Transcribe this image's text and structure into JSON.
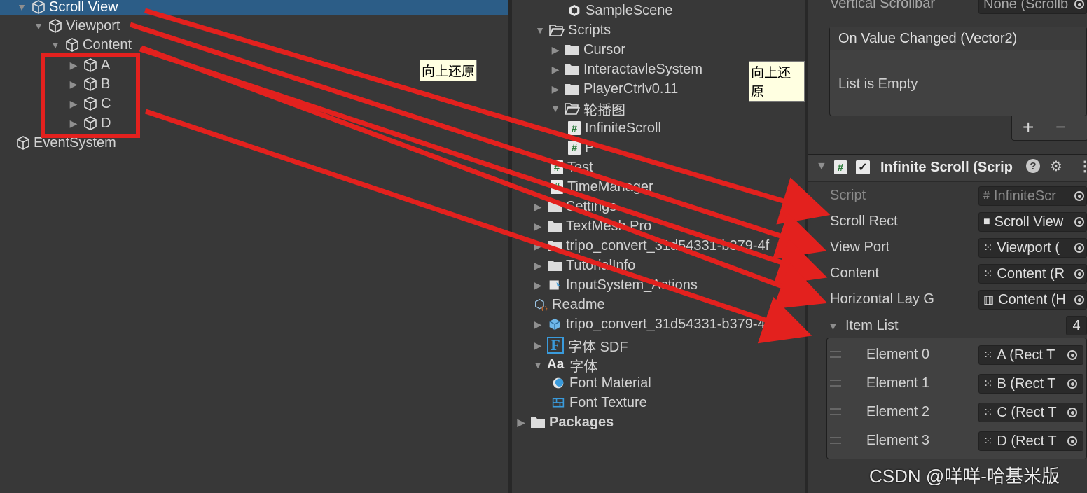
{
  "hierarchy": {
    "items": [
      {
        "label": "Scroll View",
        "expanded": true,
        "selected": true
      },
      {
        "label": "Viewport",
        "expanded": true
      },
      {
        "label": "Content",
        "expanded": true
      },
      {
        "label": "A"
      },
      {
        "label": "B"
      },
      {
        "label": "C"
      },
      {
        "label": "D"
      },
      {
        "label": "EventSystem"
      }
    ],
    "tooltip": "向上还原"
  },
  "project": {
    "items": [
      {
        "label": "SampleScene",
        "icon": "unity-scene-icon"
      },
      {
        "label": "Scripts",
        "icon": "folder-open-icon"
      },
      {
        "label": "Cursor",
        "icon": "folder-icon"
      },
      {
        "label": "InteractavleSystem",
        "icon": "folder-icon"
      },
      {
        "label": "PlayerCtrlv0.11",
        "icon": "folder-icon"
      },
      {
        "label": "轮播图",
        "icon": "folder-open-icon"
      },
      {
        "label": "InfiniteScroll",
        "icon": "script-icon"
      },
      {
        "label": "P",
        "icon": "script-icon"
      },
      {
        "label": "Test",
        "icon": "script-icon"
      },
      {
        "label": "TimeManager",
        "icon": "script-icon"
      },
      {
        "label": "Settings",
        "icon": "folder-icon"
      },
      {
        "label": "TextMesh Pro",
        "icon": "folder-icon"
      },
      {
        "label": "tripo_convert_31d54331-b379-4f",
        "icon": "folder-icon"
      },
      {
        "label": "TutorialInfo",
        "icon": "folder-icon"
      },
      {
        "label": "InputSystem_Actions",
        "icon": "input-actions-icon"
      },
      {
        "label": "Readme",
        "icon": "readme-icon"
      },
      {
        "label": "tripo_convert_31d54331-b379-4f",
        "icon": "prefab-icon"
      },
      {
        "label": "字体 SDF",
        "icon": "font-asset-icon"
      },
      {
        "label": "字体",
        "icon": "font-icon"
      },
      {
        "label": "Font Material",
        "icon": "material-icon"
      },
      {
        "label": "Font Texture",
        "icon": "texture-icon"
      },
      {
        "label": "Packages",
        "icon": "folder-icon"
      }
    ],
    "tooltip": "向上还原"
  },
  "inspector": {
    "vertical_scrollbar_label": "Vertical Scrollbar",
    "vertical_scrollbar_value": "None (Scrollb",
    "event_title": "On Value Changed (Vector2)",
    "event_empty": "List is Empty",
    "plus": "+",
    "minus": "−",
    "component_title": "Infinite Scroll (Scrip",
    "fields": [
      {
        "label": "Script",
        "value": "InfiniteScr",
        "disabled": true
      },
      {
        "label": "Scroll Rect",
        "value": "Scroll View"
      },
      {
        "label": "View Port",
        "value": "Viewport ("
      },
      {
        "label": "Content",
        "value": "Content (R"
      },
      {
        "label": "Horizontal Lay G",
        "value": "Content (H"
      }
    ],
    "item_list_label": "Item List",
    "item_list_count": "4",
    "elements": [
      {
        "label": "Element 0",
        "value": "A (Rect T"
      },
      {
        "label": "Element 1",
        "value": "B (Rect T"
      },
      {
        "label": "Element 2",
        "value": "C (Rect T"
      },
      {
        "label": "Element 3",
        "value": "D (Rect T"
      }
    ]
  },
  "watermark": "CSDN @咩咩-哈基米版",
  "colors": {
    "annotation": "#e3211e",
    "selection": "#2c5d87"
  }
}
